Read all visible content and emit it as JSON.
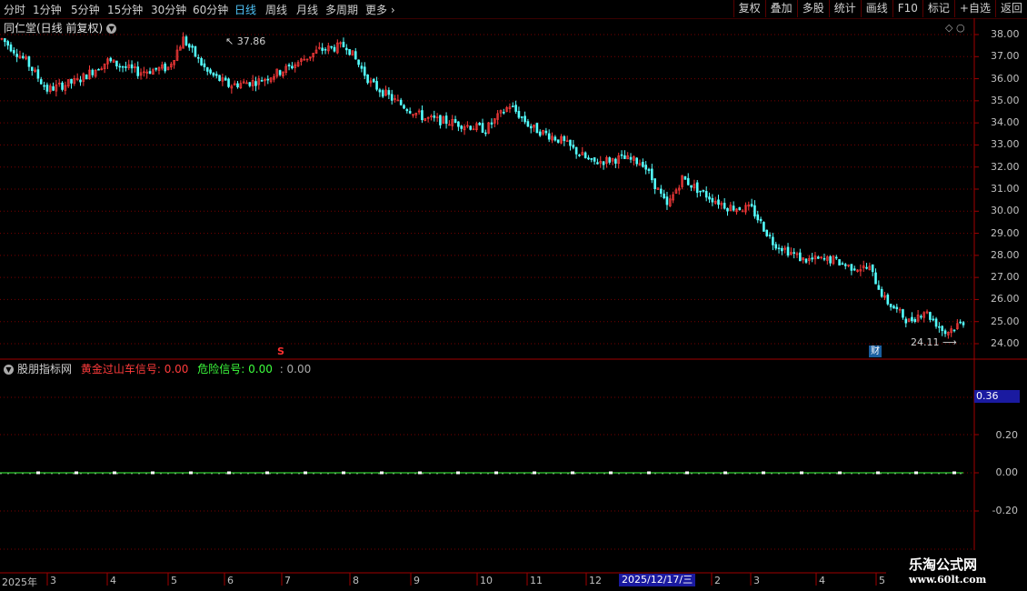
{
  "toolbar": {
    "periods": [
      "分时",
      "1分钟",
      "5分钟",
      "15分钟",
      "30分钟",
      "60分钟",
      "日线",
      "周线",
      "月线",
      "多周期",
      "更多"
    ],
    "active_period": "日线",
    "right_buttons": [
      "复权",
      "叠加",
      "多股",
      "统计",
      "画线",
      "F10",
      "标记",
      "+自选",
      "返回"
    ]
  },
  "chart": {
    "title": "同仁堂(日线 前复权)",
    "high_label": "37.86",
    "low_label": "24.11",
    "fin_badge": "财",
    "s_marker": "S",
    "price_axis": [
      "38.00",
      "37.00",
      "36.00",
      "35.00",
      "34.00",
      "33.00",
      "32.00",
      "31.00",
      "30.00",
      "29.00",
      "28.00",
      "27.00",
      "26.00",
      "25.00",
      "24.00"
    ],
    "colors": {
      "up": "#ff3b3b",
      "down": "#54ffff",
      "grid": "#7a0000",
      "border": "#a00000"
    }
  },
  "indicator": {
    "name": "股朋指标网",
    "gold_label": "黄金过山车信号",
    "gold_value": ": 0.00",
    "danger_label": "危险信号",
    "danger_value": ": 0.00",
    "extra_value": ": 0.00",
    "current_value": "0.36",
    "axis": [
      "0.20",
      "0.00",
      "-0.20"
    ]
  },
  "date_axis": {
    "year": "2025年",
    "months": [
      "3",
      "4",
      "5",
      "6",
      "7",
      "8",
      "9",
      "10",
      "11",
      "12",
      "2",
      "3",
      "4",
      "5"
    ],
    "selected_date": "2025/12/17/三"
  },
  "watermark": {
    "line1": "乐淘公式网",
    "line2": "www.60lt.com"
  }
}
